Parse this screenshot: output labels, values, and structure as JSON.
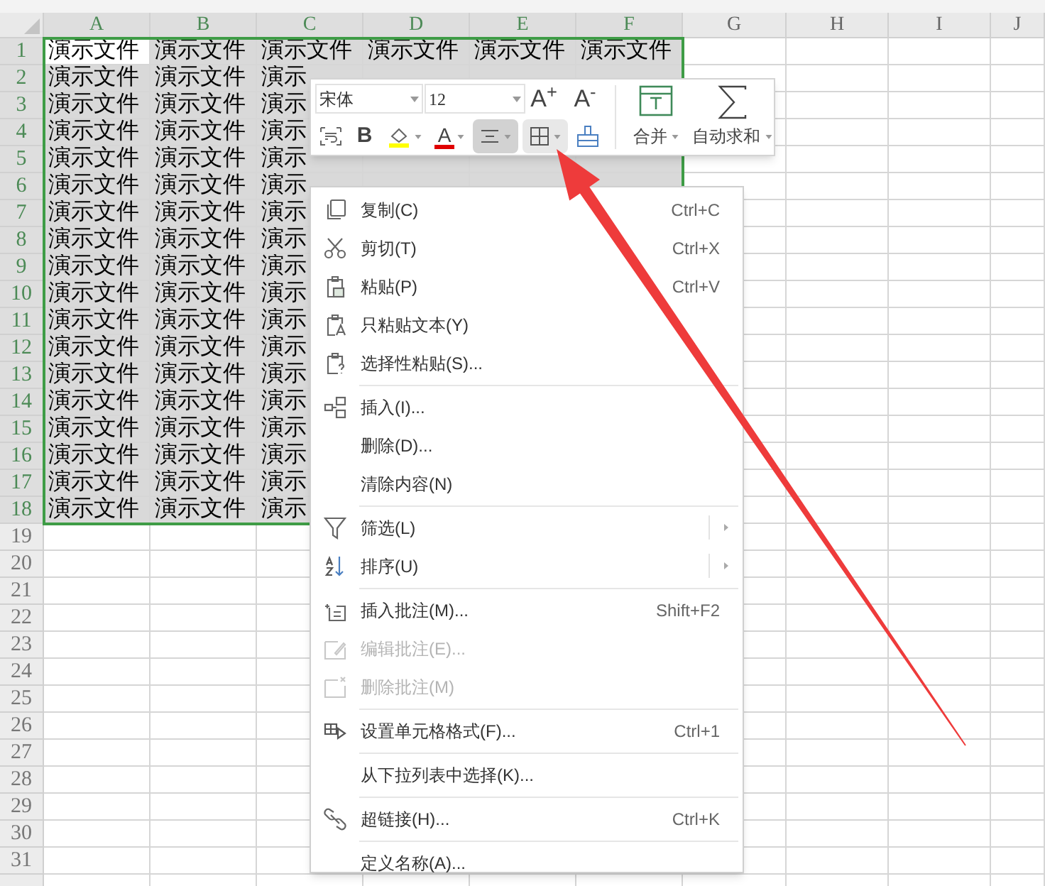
{
  "columns": [
    {
      "label": "A",
      "selected": true
    },
    {
      "label": "B",
      "selected": true
    },
    {
      "label": "C",
      "selected": true
    },
    {
      "label": "D",
      "selected": true
    },
    {
      "label": "E",
      "selected": true
    },
    {
      "label": "F",
      "selected": true
    },
    {
      "label": "G",
      "selected": false
    },
    {
      "label": "H",
      "selected": false
    },
    {
      "label": "I",
      "selected": false
    },
    {
      "label": "J",
      "selected": false
    }
  ],
  "rows": [
    {
      "label": "1",
      "selected": true,
      "cells": [
        {
          "text": "演示文件",
          "active": true
        },
        {
          "text": "演示文件",
          "active": false
        },
        {
          "text": "演示文件",
          "active": false
        },
        {
          "text": "演示文件",
          "active": false
        },
        {
          "text": "演示文件",
          "active": false
        },
        {
          "text": "演示文件",
          "active": false
        }
      ]
    },
    {
      "label": "2",
      "selected": true,
      "cells": [
        {
          "text": "演示文件",
          "active": false
        },
        {
          "text": "演示文件",
          "active": false
        },
        {
          "text": "演示",
          "active": false
        },
        null,
        null,
        null
      ]
    },
    {
      "label": "3",
      "selected": true,
      "cells": [
        {
          "text": "演示文件",
          "active": false
        },
        {
          "text": "演示文件",
          "active": false
        },
        {
          "text": "演示",
          "active": false
        },
        null,
        null,
        null
      ]
    },
    {
      "label": "4",
      "selected": true,
      "cells": [
        {
          "text": "演示文件",
          "active": false
        },
        {
          "text": "演示文件",
          "active": false
        },
        {
          "text": "演示",
          "active": false
        },
        null,
        null,
        null
      ]
    },
    {
      "label": "5",
      "selected": true,
      "cells": [
        {
          "text": "演示文件",
          "active": false
        },
        {
          "text": "演示文件",
          "active": false
        },
        {
          "text": "演示",
          "active": false
        },
        null,
        null,
        null
      ]
    },
    {
      "label": "6",
      "selected": true,
      "cells": [
        {
          "text": "演示文件",
          "active": false
        },
        {
          "text": "演示文件",
          "active": false
        },
        {
          "text": "演示",
          "active": false
        },
        null,
        null,
        null
      ]
    },
    {
      "label": "7",
      "selected": true,
      "cells": [
        {
          "text": "演示文件",
          "active": false
        },
        {
          "text": "演示文件",
          "active": false
        },
        {
          "text": "演示",
          "active": false
        },
        null,
        null,
        null
      ]
    },
    {
      "label": "8",
      "selected": true,
      "cells": [
        {
          "text": "演示文件",
          "active": false
        },
        {
          "text": "演示文件",
          "active": false
        },
        {
          "text": "演示",
          "active": false
        },
        null,
        null,
        null
      ]
    },
    {
      "label": "9",
      "selected": true,
      "cells": [
        {
          "text": "演示文件",
          "active": false
        },
        {
          "text": "演示文件",
          "active": false
        },
        {
          "text": "演示",
          "active": false
        },
        null,
        null,
        null
      ]
    },
    {
      "label": "10",
      "selected": true,
      "cells": [
        {
          "text": "演示文件",
          "active": false
        },
        {
          "text": "演示文件",
          "active": false
        },
        {
          "text": "演示",
          "active": false
        },
        null,
        null,
        null
      ]
    },
    {
      "label": "11",
      "selected": true,
      "cells": [
        {
          "text": "演示文件",
          "active": false
        },
        {
          "text": "演示文件",
          "active": false
        },
        {
          "text": "演示",
          "active": false
        },
        null,
        null,
        null
      ]
    },
    {
      "label": "12",
      "selected": true,
      "cells": [
        {
          "text": "演示文件",
          "active": false
        },
        {
          "text": "演示文件",
          "active": false
        },
        {
          "text": "演示",
          "active": false
        },
        null,
        null,
        null
      ]
    },
    {
      "label": "13",
      "selected": true,
      "cells": [
        {
          "text": "演示文件",
          "active": false
        },
        {
          "text": "演示文件",
          "active": false
        },
        {
          "text": "演示",
          "active": false
        },
        null,
        null,
        null
      ]
    },
    {
      "label": "14",
      "selected": true,
      "cells": [
        {
          "text": "演示文件",
          "active": false
        },
        {
          "text": "演示文件",
          "active": false
        },
        {
          "text": "演示",
          "active": false
        },
        null,
        null,
        null
      ]
    },
    {
      "label": "15",
      "selected": true,
      "cells": [
        {
          "text": "演示文件",
          "active": false
        },
        {
          "text": "演示文件",
          "active": false
        },
        {
          "text": "演示",
          "active": false
        },
        null,
        null,
        null
      ]
    },
    {
      "label": "16",
      "selected": true,
      "cells": [
        {
          "text": "演示文件",
          "active": false
        },
        {
          "text": "演示文件",
          "active": false
        },
        {
          "text": "演示",
          "active": false
        },
        null,
        null,
        null
      ]
    },
    {
      "label": "17",
      "selected": true,
      "cells": [
        {
          "text": "演示文件",
          "active": false
        },
        {
          "text": "演示文件",
          "active": false
        },
        {
          "text": "演示",
          "active": false
        },
        null,
        null,
        null
      ]
    },
    {
      "label": "18",
      "selected": true,
      "cells": [
        {
          "text": "演示文件",
          "active": false
        },
        {
          "text": "演示文件",
          "active": false
        },
        {
          "text": "演示",
          "active": false
        },
        null,
        null,
        null
      ]
    },
    {
      "label": "19",
      "selected": false
    },
    {
      "label": "20",
      "selected": false
    },
    {
      "label": "21",
      "selected": false
    },
    {
      "label": "22",
      "selected": false
    },
    {
      "label": "23",
      "selected": false
    },
    {
      "label": "24",
      "selected": false
    },
    {
      "label": "25",
      "selected": false
    },
    {
      "label": "26",
      "selected": false
    },
    {
      "label": "27",
      "selected": false
    },
    {
      "label": "28",
      "selected": false
    },
    {
      "label": "29",
      "selected": false
    },
    {
      "label": "30",
      "selected": false
    },
    {
      "label": "31",
      "selected": false
    }
  ],
  "mini_toolbar": {
    "font_name": "宋体",
    "font_size": "12",
    "grow_font": "A$^{+}$",
    "shrink_font": "A$^{-}$",
    "tools": [
      {
        "kind": "wrap",
        "selected": false,
        "hovered": false
      },
      {
        "kind": "bold",
        "label": "B",
        "selected": false,
        "hovered": false
      },
      {
        "kind": "fill",
        "color": "#ffff00",
        "selected": false,
        "hovered": false
      },
      {
        "kind": "font_color",
        "label": "A",
        "color": "#e00000",
        "selected": false,
        "hovered": false
      },
      {
        "kind": "align",
        "selected": true,
        "hovered": false
      },
      {
        "kind": "border",
        "selected": false,
        "hovered": true
      },
      {
        "kind": "eraser",
        "selected": false,
        "hovered": false
      }
    ],
    "merge": "合并",
    "autosum": "自动求和"
  },
  "context_menu": [
    {
      "kind": "item",
      "label": "复制(C)",
      "shortcut": "Ctrl+C",
      "disabled": false,
      "submenu": false
    },
    {
      "kind": "item",
      "label": "剪切(T)",
      "shortcut": "Ctrl+X",
      "disabled": false,
      "submenu": false
    },
    {
      "kind": "item",
      "label": "粘贴(P)",
      "shortcut": "Ctrl+V",
      "disabled": false,
      "submenu": false
    },
    {
      "kind": "item",
      "label": "只粘贴文本(Y)",
      "disabled": false,
      "submenu": false
    },
    {
      "kind": "item",
      "label": "选择性粘贴(S)...",
      "disabled": false,
      "submenu": false
    },
    {
      "kind": "separator"
    },
    {
      "kind": "item",
      "label": "插入(I)...",
      "disabled": false,
      "submenu": false
    },
    {
      "kind": "item",
      "label": "删除(D)...",
      "disabled": false,
      "submenu": false
    },
    {
      "kind": "item",
      "label": "清除内容(N)",
      "disabled": false,
      "submenu": false
    },
    {
      "kind": "separator"
    },
    {
      "kind": "item",
      "label": "筛选(L)",
      "disabled": false,
      "submenu": true
    },
    {
      "kind": "item",
      "label": "排序(U)",
      "disabled": false,
      "submenu": true
    },
    {
      "kind": "separator"
    },
    {
      "kind": "item",
      "label": "插入批注(M)...",
      "shortcut": "Shift+F2",
      "disabled": false,
      "submenu": false
    },
    {
      "kind": "item",
      "label": "编辑批注(E)...",
      "disabled": true,
      "submenu": false
    },
    {
      "kind": "item",
      "label": "删除批注(M)",
      "disabled": true,
      "submenu": false
    },
    {
      "kind": "separator"
    },
    {
      "kind": "item",
      "label": "设置单元格格式(F)...",
      "shortcut": "Ctrl+1",
      "disabled": false,
      "submenu": false
    },
    {
      "kind": "separator"
    },
    {
      "kind": "item",
      "label": "从下拉列表中选择(K)...",
      "disabled": false,
      "submenu": false
    },
    {
      "kind": "separator"
    },
    {
      "kind": "item",
      "label": "超链接(H)...",
      "shortcut": "Ctrl+K",
      "disabled": false,
      "submenu": false
    },
    {
      "kind": "separator"
    },
    {
      "kind": "item",
      "label": "定义名称(A)...",
      "disabled": false,
      "submenu": false
    }
  ]
}
